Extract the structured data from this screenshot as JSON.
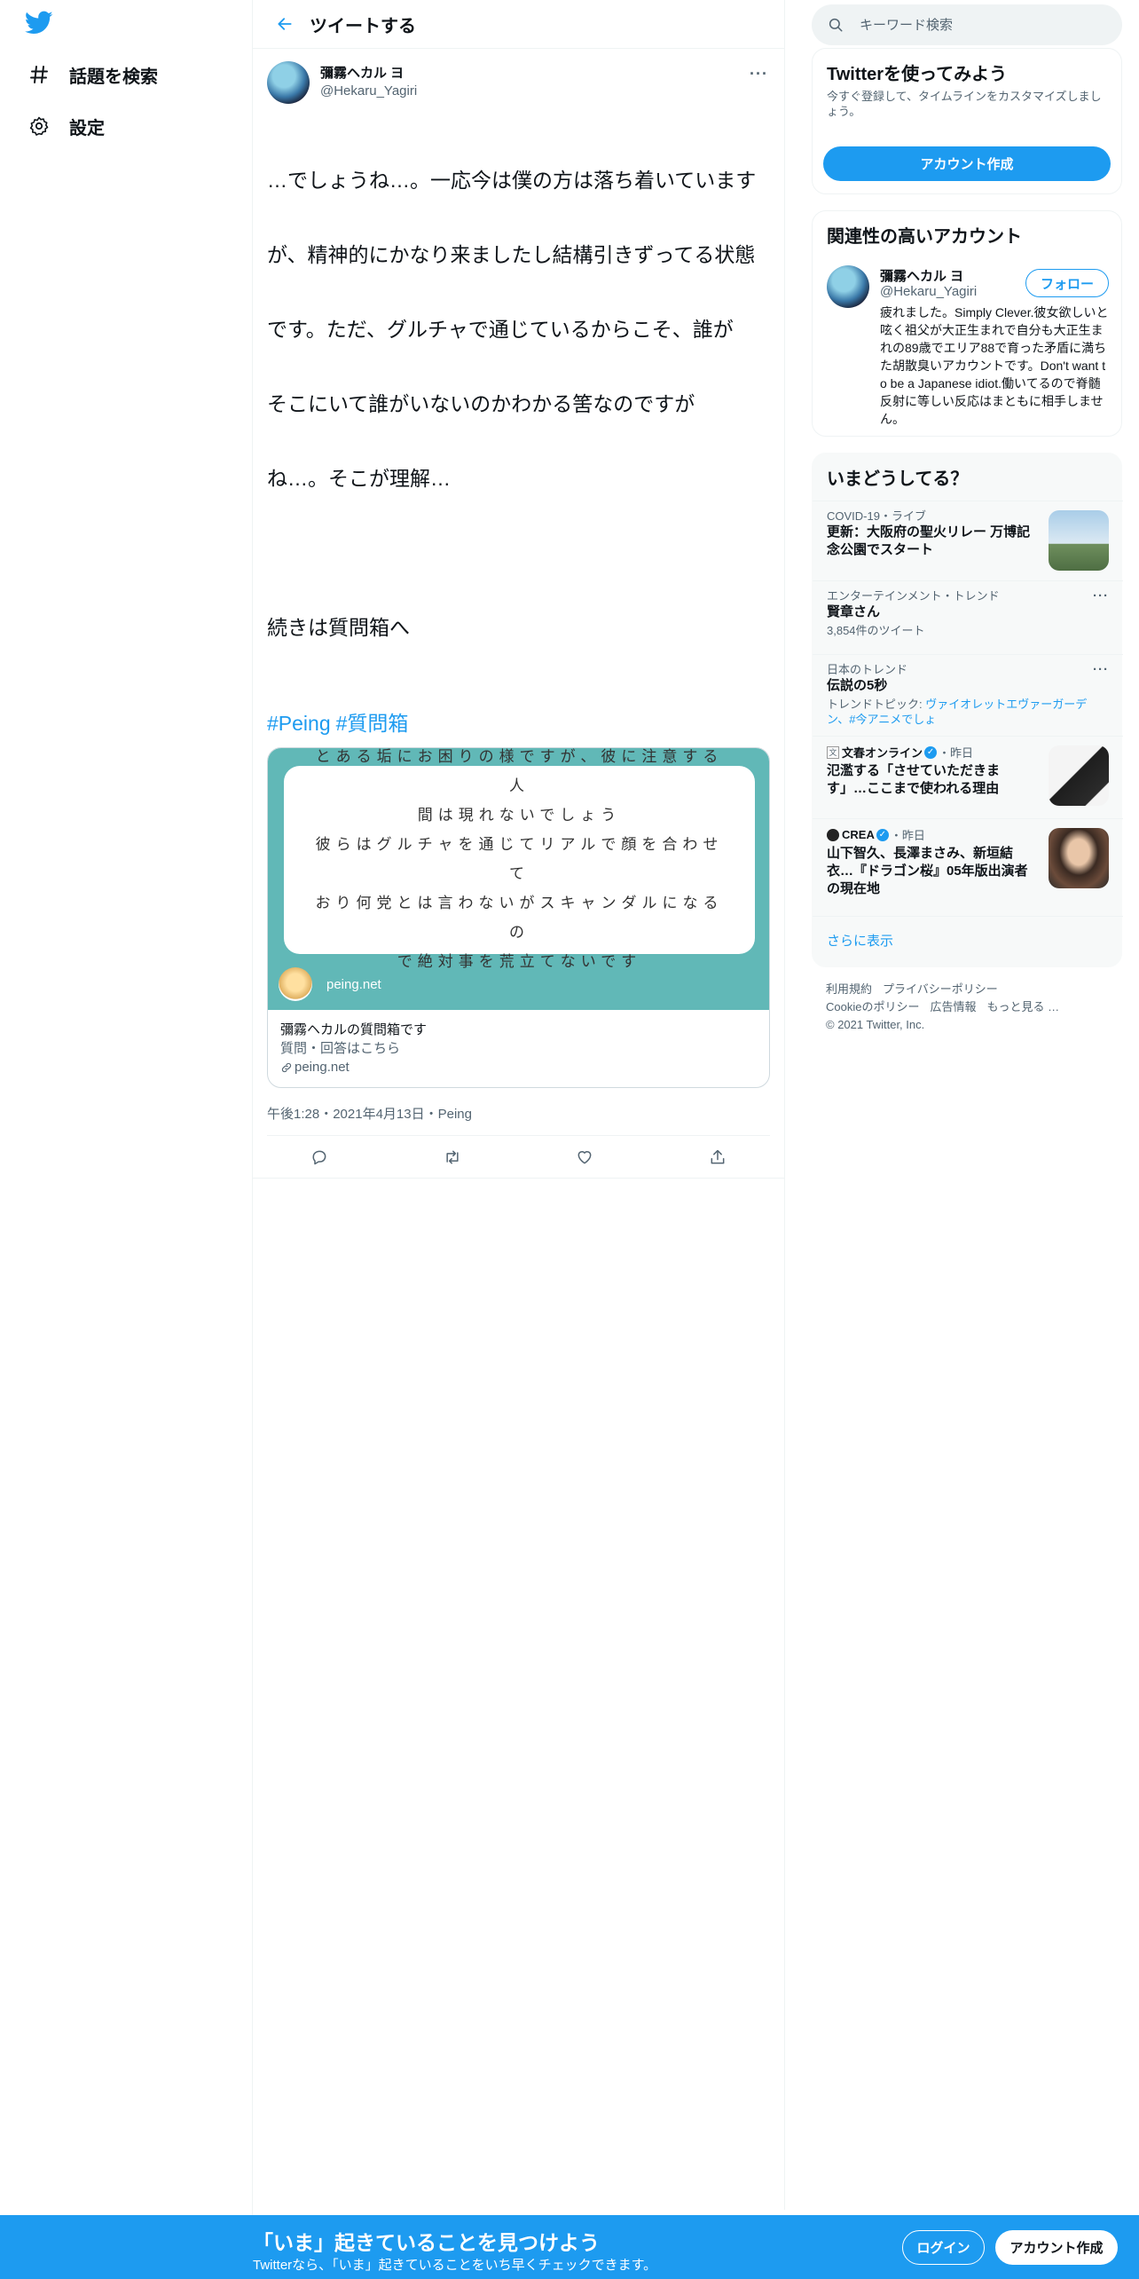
{
  "nav": {
    "logo_icon": "twitter-bird-icon",
    "items": [
      {
        "label": "話題を検索",
        "icon": "hash-icon"
      },
      {
        "label": "設定",
        "icon": "gear-icon"
      }
    ]
  },
  "header": {
    "title": "ツイートする"
  },
  "tweet": {
    "author_name": "彌霧ヘカル ヨ",
    "author_handle": "@Hekaru_Yagiri",
    "text_lines": [
      "…でしょうね…。一応今は僕の方は落ち着いています",
      "が、精神的にかなり来ましたし結構引きずってる状態",
      "です。ただ、グルチャで通じているからこそ、誰が",
      "そこにいて誰がいないのかわかる筈なのですが",
      "ね…。そこが理解…",
      "",
      "続きは質問箱へ"
    ],
    "hashtags": [
      "#Peing",
      "#質問箱"
    ],
    "card": {
      "question_lines": [
        "とある垢にお困りの様ですが、彼に注意する人",
        "間は現れないでしょう",
        "彼らはグルチャを通じてリアルで顔を合わせて",
        "おり何党とは言わないがスキャンダルになるの",
        "で絶対事を荒立てないです"
      ],
      "site_name": "peing.net",
      "title": "彌霧ヘカルの質問箱です",
      "description": "質問・回答はこちら",
      "domain": "peing.net"
    },
    "timestamp": "午後1:28・2021年4月13日・Peing"
  },
  "search": {
    "placeholder": "キーワード検索"
  },
  "signup_panel": {
    "title": "Twitterを使ってみよう",
    "subtitle": "今すぐ登録して、タイムラインをカスタマイズしましょう。",
    "button": "アカウント作成"
  },
  "related": {
    "title": "関連性の高いアカウント",
    "name": "彌霧ヘカル ヨ",
    "handle": "@Hekaru_Yagiri",
    "follow": "フォロー",
    "bio": "疲れました。Simply Clever.彼女欲しいと呟く祖父が大正生まれで自分も大正生まれの89歳でエリア88で育った矛盾に満ちた胡散臭いアカウントです。Don't want to be a Japanese idiot.働いてるので脊髄反射に等しい反応はまともに相手しません。"
  },
  "trends": {
    "title": "いまどうしてる？",
    "items": [
      {
        "context": "COVID-19・ライブ",
        "title": "更新：大阪府の聖火リレー 万博記念公園でスタート"
      },
      {
        "context": "エンターテインメント・トレンド",
        "title": "賢章さん",
        "count": "3,854件のツイート"
      },
      {
        "context": "日本のトレンド",
        "title": "伝説の5秒",
        "topic_prefix": "トレンドトピック: ",
        "topic_links": "ヴァイオレットエヴァーガーデン、#今アニメでしょ"
      },
      {
        "source": "文春オンライン",
        "time": "・昨日",
        "title": "氾濫する「させていただきます」…ここまで使われる理由"
      },
      {
        "source": "CREA",
        "time": "・昨日",
        "title": "山下智久、長澤まさみ、新垣結衣…『ドラゴン桜』05年版出演者の現在地"
      }
    ],
    "show_more": "さらに表示"
  },
  "footer": {
    "links": [
      "利用規約",
      "プライバシーポリシー",
      "Cookieのポリシー",
      "広告情報",
      "もっと見る …"
    ],
    "copyright": "© 2021 Twitter, Inc."
  },
  "bottom_bar": {
    "title": "「いま」起きていることを見つけよう",
    "subtitle": "Twitterなら、「いま」起きていることをいち早くチェックできます。",
    "login": "ログイン",
    "signup": "アカウント作成"
  },
  "colors": {
    "accent": "#1d9bf0",
    "card_bg": "#61b8b7"
  }
}
